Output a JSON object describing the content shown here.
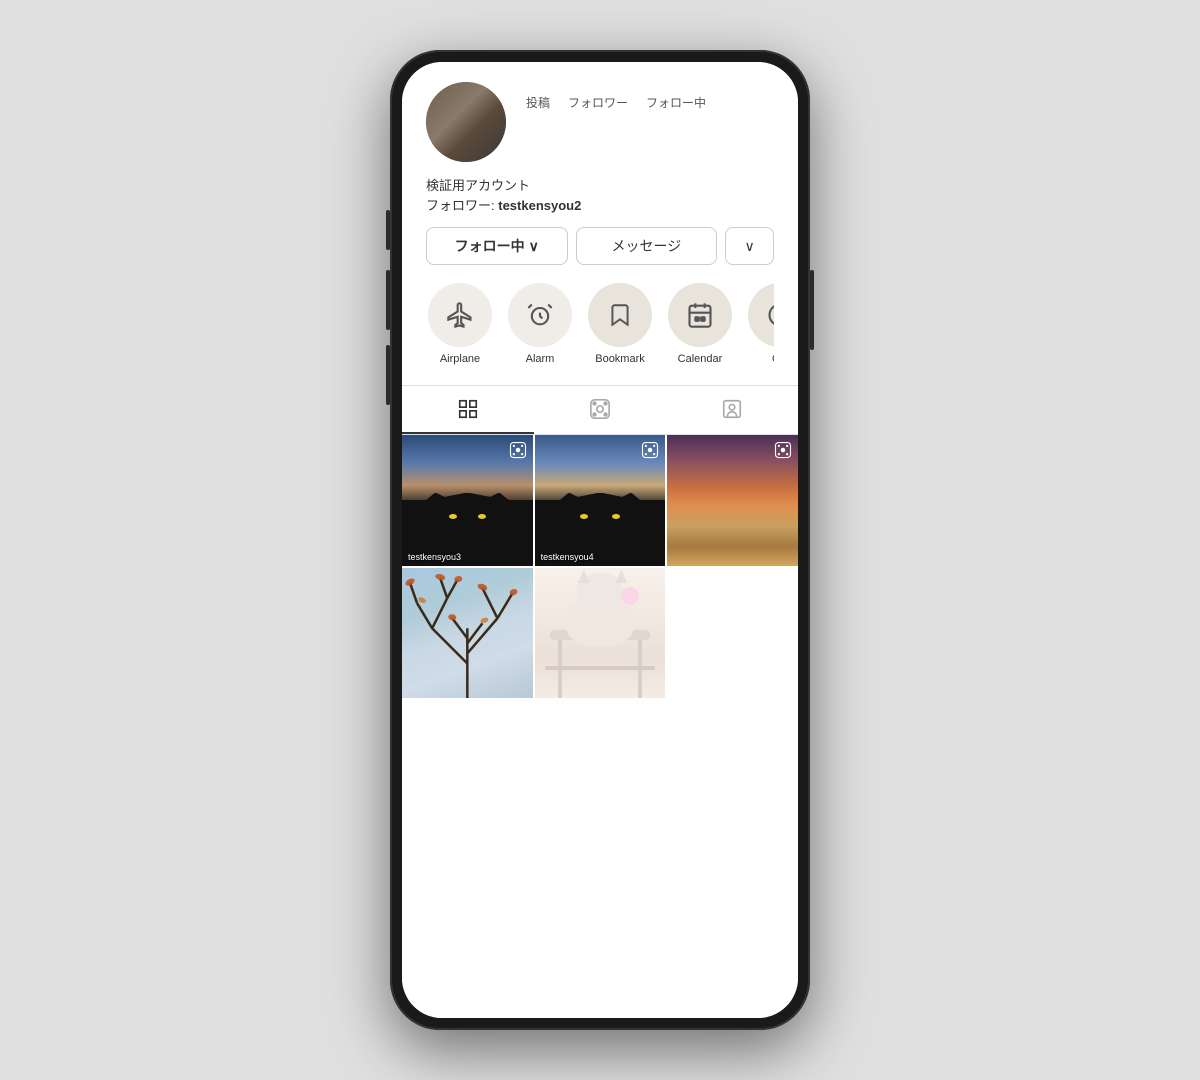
{
  "phone": {
    "profile": {
      "bio_line1": "検証用アカウント",
      "bio_line2_prefix": "フォロワー: ",
      "bio_line2_value": "testkensyou2",
      "stats": [
        {
          "label": "投稿",
          "value": ""
        },
        {
          "label": "フォロワー",
          "value": ""
        },
        {
          "label": "フォロー中",
          "value": ""
        }
      ]
    },
    "buttons": {
      "follow": "フォロー中",
      "follow_chevron": "∨",
      "message": "メッセージ",
      "dropdown": "∨"
    },
    "highlights": [
      {
        "label": "Airplane",
        "icon": "✈"
      },
      {
        "label": "Alarm",
        "icon": "⏰"
      },
      {
        "label": "Bookmark",
        "icon": "🔖"
      },
      {
        "label": "Calendar",
        "icon": "📅"
      },
      {
        "label": "CD",
        "icon": "💿"
      }
    ],
    "tabs": [
      {
        "label": "grid",
        "active": true
      },
      {
        "label": "reels",
        "active": false
      },
      {
        "label": "tagged",
        "active": false
      }
    ],
    "grid": {
      "cells": [
        {
          "type": "sky-cat1",
          "has_reel": true,
          "username": "testkensyou3"
        },
        {
          "type": "sky-cat2",
          "has_reel": true,
          "username": "testkensyou4"
        },
        {
          "type": "sky3",
          "has_reel": true,
          "username": ""
        },
        {
          "type": "tree",
          "has_reel": false,
          "username": ""
        },
        {
          "type": "cat-white",
          "has_reel": false,
          "username": ""
        },
        {
          "type": "empty",
          "has_reel": false,
          "username": ""
        }
      ]
    }
  }
}
